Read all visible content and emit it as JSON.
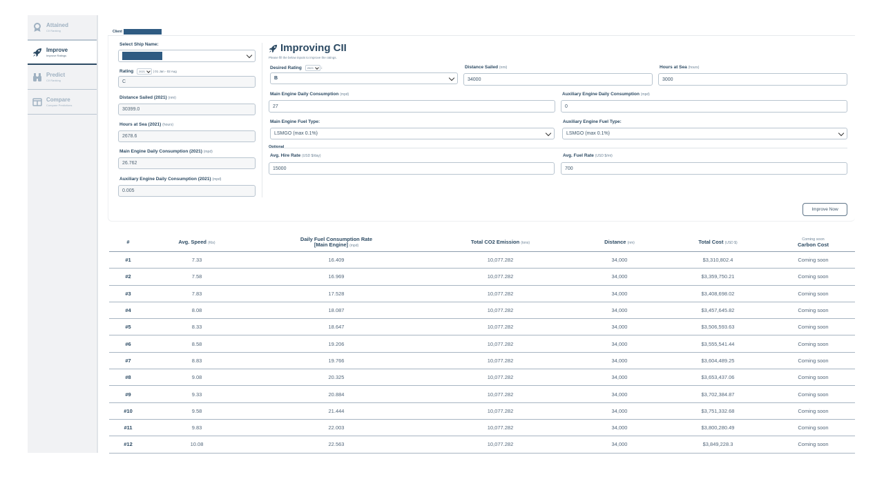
{
  "nav": [
    {
      "title": "Attained",
      "sub": "CII Ranking",
      "icon": "award-icon",
      "active": false
    },
    {
      "title": "Improve",
      "sub": "Improve Ratings",
      "icon": "rocket-icon",
      "active": true
    },
    {
      "title": "Predict",
      "sub": "CII Ranking",
      "icon": "binoculars-icon",
      "active": false
    },
    {
      "title": "Compare",
      "sub": "Compare Predictions",
      "icon": "compare-icon",
      "active": false
    }
  ],
  "client_label": "Client",
  "left": {
    "ship_label": "Select Ship Name:",
    "rating_label": "Rating",
    "rating_year": "2021",
    "rating_range": "| 01 Jan - 02 Aug",
    "rating_value": "C",
    "distance_label": "Distance Sailed (2021)",
    "distance_unit": "(nmi)",
    "distance_value": "30399.0",
    "hours_label": "Hours at Sea (2021)",
    "hours_unit": "(hours)",
    "hours_value": "2678.6",
    "main_label": "Main Engine Daily Consumption (2021)",
    "main_unit": "(mpd)",
    "main_value": "26.762",
    "aux_label": "Auxiliary Engine Daily Consumption (2021)",
    "aux_unit": "(mpd)",
    "aux_value": "0.005"
  },
  "right": {
    "title": "Improving CII",
    "subtitle": "Please fill the below inputs to improve the ratings.",
    "desired_label": "Desired Rating",
    "desired_year": "2023",
    "desired_info": "i",
    "desired_value": "B",
    "distance_label": "Distance Sailed",
    "distance_unit": "(nmi)",
    "distance_value": "34000",
    "hours_label": "Hours at Sea",
    "hours_unit": "(hours)",
    "hours_value": "3000",
    "main_label": "Main Engine Daily Consumption",
    "main_unit": "(mpd)",
    "main_value": "27",
    "aux_label": "Auxiliary Engine Daily Consumption",
    "aux_unit": "(mpd)",
    "aux_value": "0",
    "main_fuel_label": "Main Engine Fuel Type:",
    "main_fuel_value": "LSMGO (max 0.1%)",
    "aux_fuel_label": "Auxiliary Engine Fuel Type:",
    "aux_fuel_value": "LSMGO (max 0.1%)",
    "optional_label": "Optional",
    "hire_label": "Avg. Hire Rate",
    "hire_unit": "(USD $/day)",
    "hire_value": "15000",
    "fuel_rate_label": "Avg. Fuel Rate",
    "fuel_rate_unit": "(USD $/mt)",
    "fuel_rate_value": "700",
    "button": "Improve Now"
  },
  "table": {
    "col_num": "#",
    "col_speed": "Avg. Speed",
    "col_speed_unit": "(Kts)",
    "col_fuel_l1": "Daily Fuel Consumption Rate",
    "col_fuel_l2": "[Main Engine]",
    "col_fuel_unit": "(mpd)",
    "col_co2": "Total CO2 Emission",
    "col_co2_unit": "(tons)",
    "col_distance": "Distance",
    "col_distance_unit": "(nm)",
    "col_cost": "Total Cost",
    "col_cost_unit": "(USD $)",
    "col_carbon_pre": "Coming soon",
    "col_carbon": "Carbon Cost",
    "rows": [
      [
        "#1",
        "7.33",
        "16.409",
        "10,077.282",
        "34,000",
        "$3,310,802.4",
        "Coming soon"
      ],
      [
        "#2",
        "7.58",
        "16.969",
        "10,077.282",
        "34,000",
        "$3,359,750.21",
        "Coming soon"
      ],
      [
        "#3",
        "7.83",
        "17.528",
        "10,077.282",
        "34,000",
        "$3,408,698.02",
        "Coming soon"
      ],
      [
        "#4",
        "8.08",
        "18.087",
        "10,077.282",
        "34,000",
        "$3,457,645.82",
        "Coming soon"
      ],
      [
        "#5",
        "8.33",
        "18.647",
        "10,077.282",
        "34,000",
        "$3,506,593.63",
        "Coming soon"
      ],
      [
        "#6",
        "8.58",
        "19.206",
        "10,077.282",
        "34,000",
        "$3,555,541.44",
        "Coming soon"
      ],
      [
        "#7",
        "8.83",
        "19.766",
        "10,077.282",
        "34,000",
        "$3,604,489.25",
        "Coming soon"
      ],
      [
        "#8",
        "9.08",
        "20.325",
        "10,077.282",
        "34,000",
        "$3,653,437.06",
        "Coming soon"
      ],
      [
        "#9",
        "9.33",
        "20.884",
        "10,077.282",
        "34,000",
        "$3,702,384.87",
        "Coming soon"
      ],
      [
        "#10",
        "9.58",
        "21.444",
        "10,077.282",
        "34,000",
        "$3,751,332.68",
        "Coming soon"
      ],
      [
        "#11",
        "9.83",
        "22.003",
        "10,077.282",
        "34,000",
        "$3,800,280.49",
        "Coming soon"
      ],
      [
        "#12",
        "10.08",
        "22.563",
        "10,077.282",
        "34,000",
        "$3,849,228.3",
        "Coming soon"
      ]
    ]
  }
}
